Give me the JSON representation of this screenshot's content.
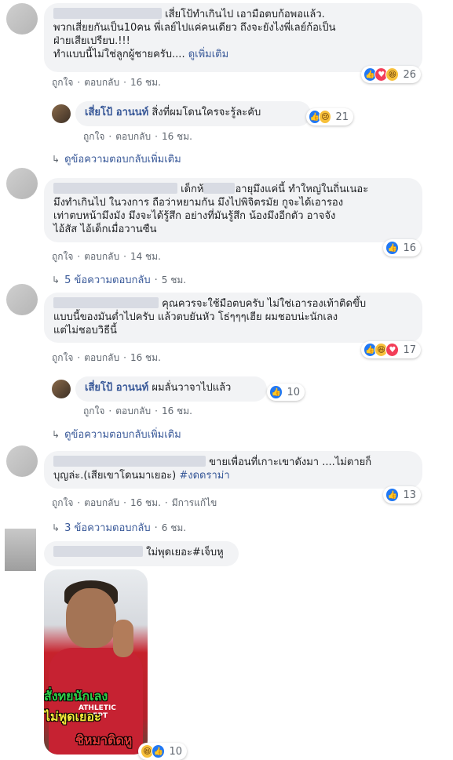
{
  "colors": {
    "link": "#385898",
    "bubble": "#f2f3f5",
    "like": "#2078f4",
    "love": "#f33e58",
    "haha": "#f7c03a"
  },
  "comments": [
    {
      "text_lines": [
        "เสี่ยโป้ทำเกินไป เอามือตบก้อพอแล้ว.",
        "พวกเสี่ยยกันเป็น10คน พี่เลย์ไปแค่คนเดียว ถึงจะยังไงพี่เลย์ก้อเป็น",
        "ฝ่ายเสียเปรียบ.!!!",
        "ทำแบบนี้ไม่ใช่ลูกผู้ชายครับ...."
      ],
      "see_more": "ดูเพิ่มเติม",
      "actions": [
        "ถูกใจ",
        "ตอบกลับ",
        "16 ชม."
      ],
      "reactions": {
        "icons": [
          "like-icon",
          "love-icon",
          "haha-icon"
        ],
        "count": "26"
      }
    },
    {
      "author": "เสี่ยโป้ อานนท์",
      "text": "สิ่งที่ผมโดนใครจะรู้ละคับ",
      "actions": [
        "ถูกใจ",
        "ตอบกลับ",
        "16 ชม."
      ],
      "reactions": {
        "icons": [
          "like-icon",
          "sad-icon"
        ],
        "count": "21"
      }
    },
    {
      "reply_link": "ดูข้อความตอบกลับเพิ่มเติม"
    },
    {
      "text_lines": [
        "เด็กห้",
        "อายุมึงแค่นี้ ทำใหญ่ในถิ่นเนอะ",
        "มึงทำเกินไป ในวงการ ถือว่าหยามกัน มึงไปพิจิตรมัย กูจะได้เอารอง",
        "เท่าตบหน้ามึงมัง มึงจะได้รู้สึก อย่างที่มันรู้สึก น้องมึงอีกตัว อาจจัง",
        "ไอ้สัส ไอ้เด็กเมื่อวานซืน"
      ],
      "actions": [
        "ถูกใจ",
        "ตอบกลับ",
        "14 ชม."
      ],
      "reactions": {
        "icons": [
          "like-icon"
        ],
        "count": "16"
      }
    },
    {
      "reply_link": "5 ข้อความตอบกลับ",
      "reply_time": "5 ชม."
    },
    {
      "text_lines": [
        "คุณควรจะใช้มือตบครับ ไม่ใช่เอารองเท้าติดขึ้บ",
        "แบบนี้ของมันต่ำไปครับ แล้วตบยันหัว โธ่ๆๆๆเฮีย ผมชอบน่ะนักเลง",
        "แต่ไม่ชอบวิธีนี้"
      ],
      "actions": [
        "ถูกใจ",
        "ตอบกลับ",
        "16 ชม."
      ],
      "reactions": {
        "icons": [
          "like-icon",
          "haha-icon",
          "love-icon"
        ],
        "count": "17"
      }
    },
    {
      "author": "เสี่ยโป้ อานนท์",
      "text": "ผมลั่นวาจาไปแล้ว",
      "actions": [
        "ถูกใจ",
        "ตอบกลับ",
        "16 ชม."
      ],
      "reactions": {
        "icons": [
          "like-icon"
        ],
        "count": "10"
      }
    },
    {
      "reply_link": "ดูข้อความตอบกลับเพิ่มเติม"
    },
    {
      "text_lines": [
        "ขายเพื่อนที่เกาะเขาดังมา ....ไม่ตายก็",
        "บุญล่ะ.(เสียเขาโดนมาเยอะ)"
      ],
      "hashtag": "#งดดราม่า",
      "actions": [
        "ถูกใจ",
        "ตอบกลับ",
        "16 ชม.",
        "มีการแก้ไข"
      ],
      "reactions": {
        "icons": [
          "like-icon"
        ],
        "count": "13"
      }
    },
    {
      "reply_link": "3 ข้อความตอบกลับ",
      "reply_time": "6 ชม."
    },
    {
      "text": "ใม่พุดเยอะ#เจ็บหู",
      "photo_caption": [
        "สั่งทยนักเลง",
        "ไม่พูดเยอะ",
        "ชิหมาติดหู"
      ],
      "photo_shirt": [
        "ATHLETIC",
        "DEPT"
      ],
      "reactions": {
        "icons": [
          "haha-icon",
          "like-icon"
        ],
        "count": "10"
      }
    }
  ]
}
